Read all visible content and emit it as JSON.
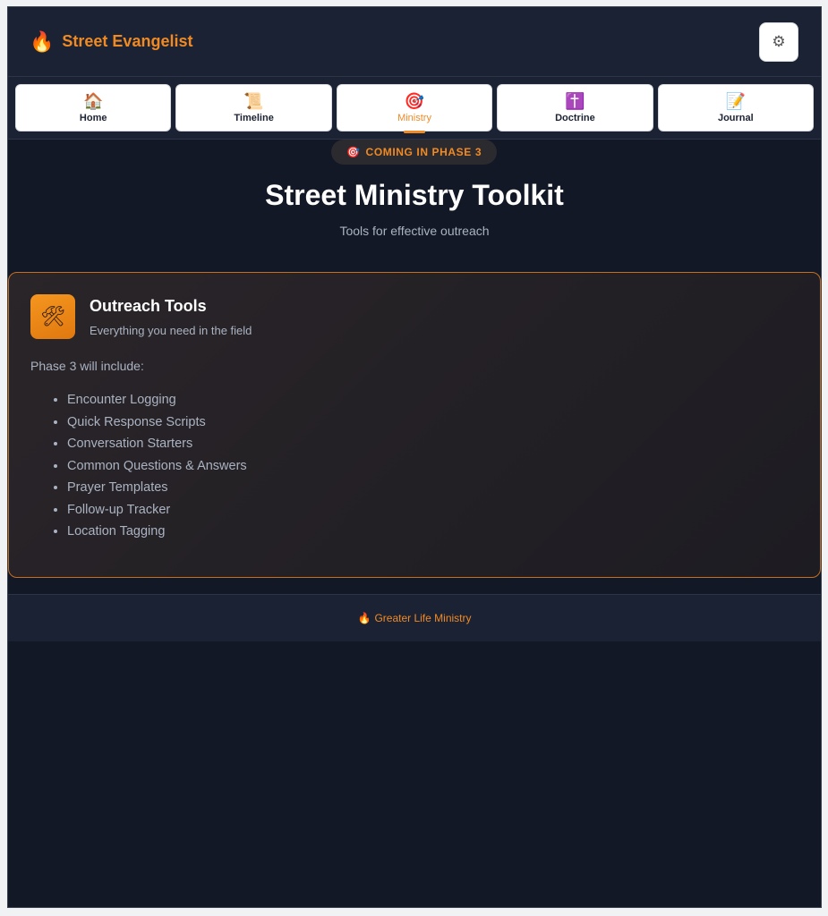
{
  "header": {
    "logo_icon": "🔥",
    "title": "Street Evangelist",
    "settings_icon": "⚙"
  },
  "nav": {
    "tabs": [
      {
        "icon": "🏠",
        "label": "Home",
        "active": false
      },
      {
        "icon": "📜",
        "label": "Timeline",
        "active": false
      },
      {
        "icon": "🎯",
        "label": "Ministry",
        "active": true
      },
      {
        "icon": "✝️",
        "label": "Doctrine",
        "active": false
      },
      {
        "icon": "📝",
        "label": "Journal",
        "active": false
      }
    ]
  },
  "main": {
    "badge": {
      "icon": "🎯",
      "label": "COMING IN PHASE 3"
    },
    "title": "Street Ministry Toolkit",
    "subtitle": "Tools for effective outreach",
    "card": {
      "icon": "🛠",
      "title": "Outreach Tools",
      "description": "Everything you need in the field",
      "intro": "Phase 3 will include:",
      "features": [
        "Encounter Logging",
        "Quick Response Scripts",
        "Conversation Starters",
        "Common Questions & Answers",
        "Prayer Templates",
        "Follow-up Tracker",
        "Location Tagging"
      ]
    }
  },
  "footer": {
    "icon": "🔥",
    "text": "Greater Life Ministry"
  },
  "colors": {
    "accent": "#f08a24",
    "background": "#121826",
    "surface": "#1b2233"
  }
}
